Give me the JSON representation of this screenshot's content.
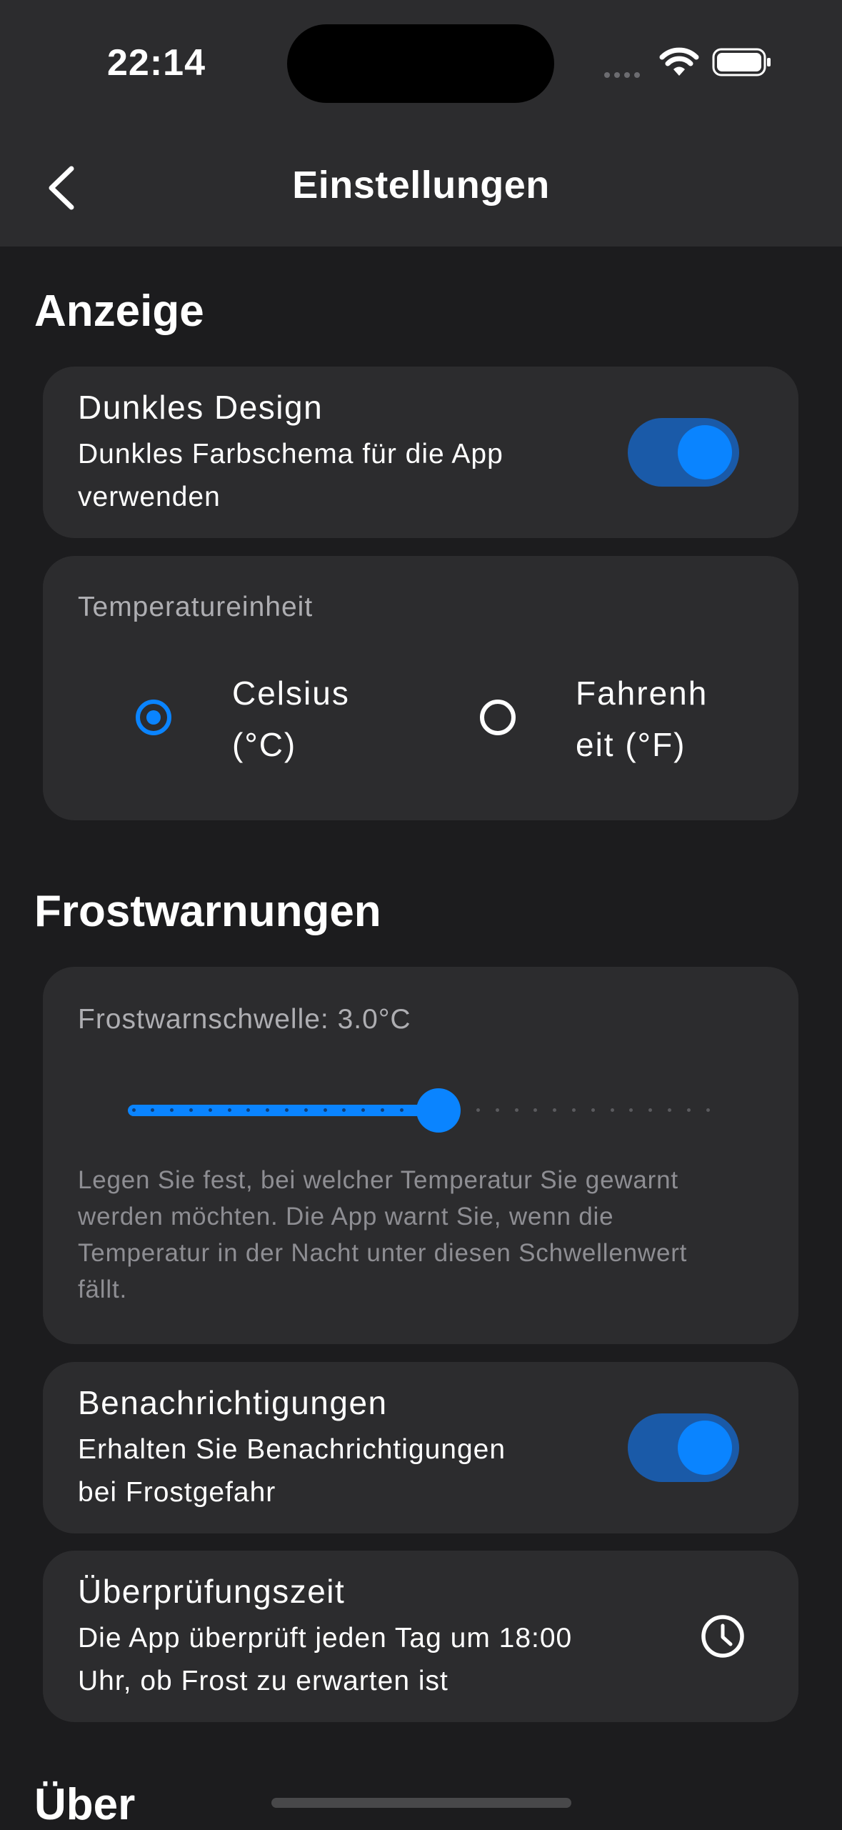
{
  "status": {
    "time": "22:14"
  },
  "nav": {
    "title": "Einstellungen"
  },
  "display": {
    "heading": "Anzeige",
    "dark_mode": {
      "title": "Dunkles Design",
      "subtitle_line1": "Dunkles Farbschema für die App",
      "subtitle_line2": "verwenden",
      "enabled": true
    },
    "temperature_unit": {
      "label": "Temperatureinheit",
      "celsius_line1": "Celsius",
      "celsius_line2": "(°C)",
      "fahrenheit_line1": "Fahrenh",
      "fahrenheit_line2": "eit (°F)",
      "selected": "celsius"
    }
  },
  "frost": {
    "heading": "Frostwarnungen",
    "threshold": {
      "label": "Frostwarnschwelle: 3.0°C",
      "value_fraction": 0.53,
      "desc_line1": "Legen Sie fest, bei welcher Temperatur Sie gewarnt",
      "desc_line2": "werden möchten. Die App warnt Sie, wenn die",
      "desc_line3": "Temperatur in der Nacht unter diesen Schwellenwert",
      "desc_line4": "fällt."
    },
    "notifications": {
      "title": "Benachrichtigungen",
      "subtitle_line1": "Erhalten Sie Benachrichtigungen",
      "subtitle_line2": "bei Frostgefahr",
      "enabled": true
    },
    "check_time": {
      "title": "Überprüfungszeit",
      "subtitle_line1": "Die App überprüft jeden Tag um 18:00",
      "subtitle_line2": "Uhr, ob Frost zu erwarten ist",
      "icon": "clock-icon"
    }
  },
  "about": {
    "heading": "Über"
  },
  "colors": {
    "accent": "#0a84ff",
    "accent_dark": "#1a5aa8",
    "card": "#2c2c2e",
    "background": "#1c1c1e"
  }
}
